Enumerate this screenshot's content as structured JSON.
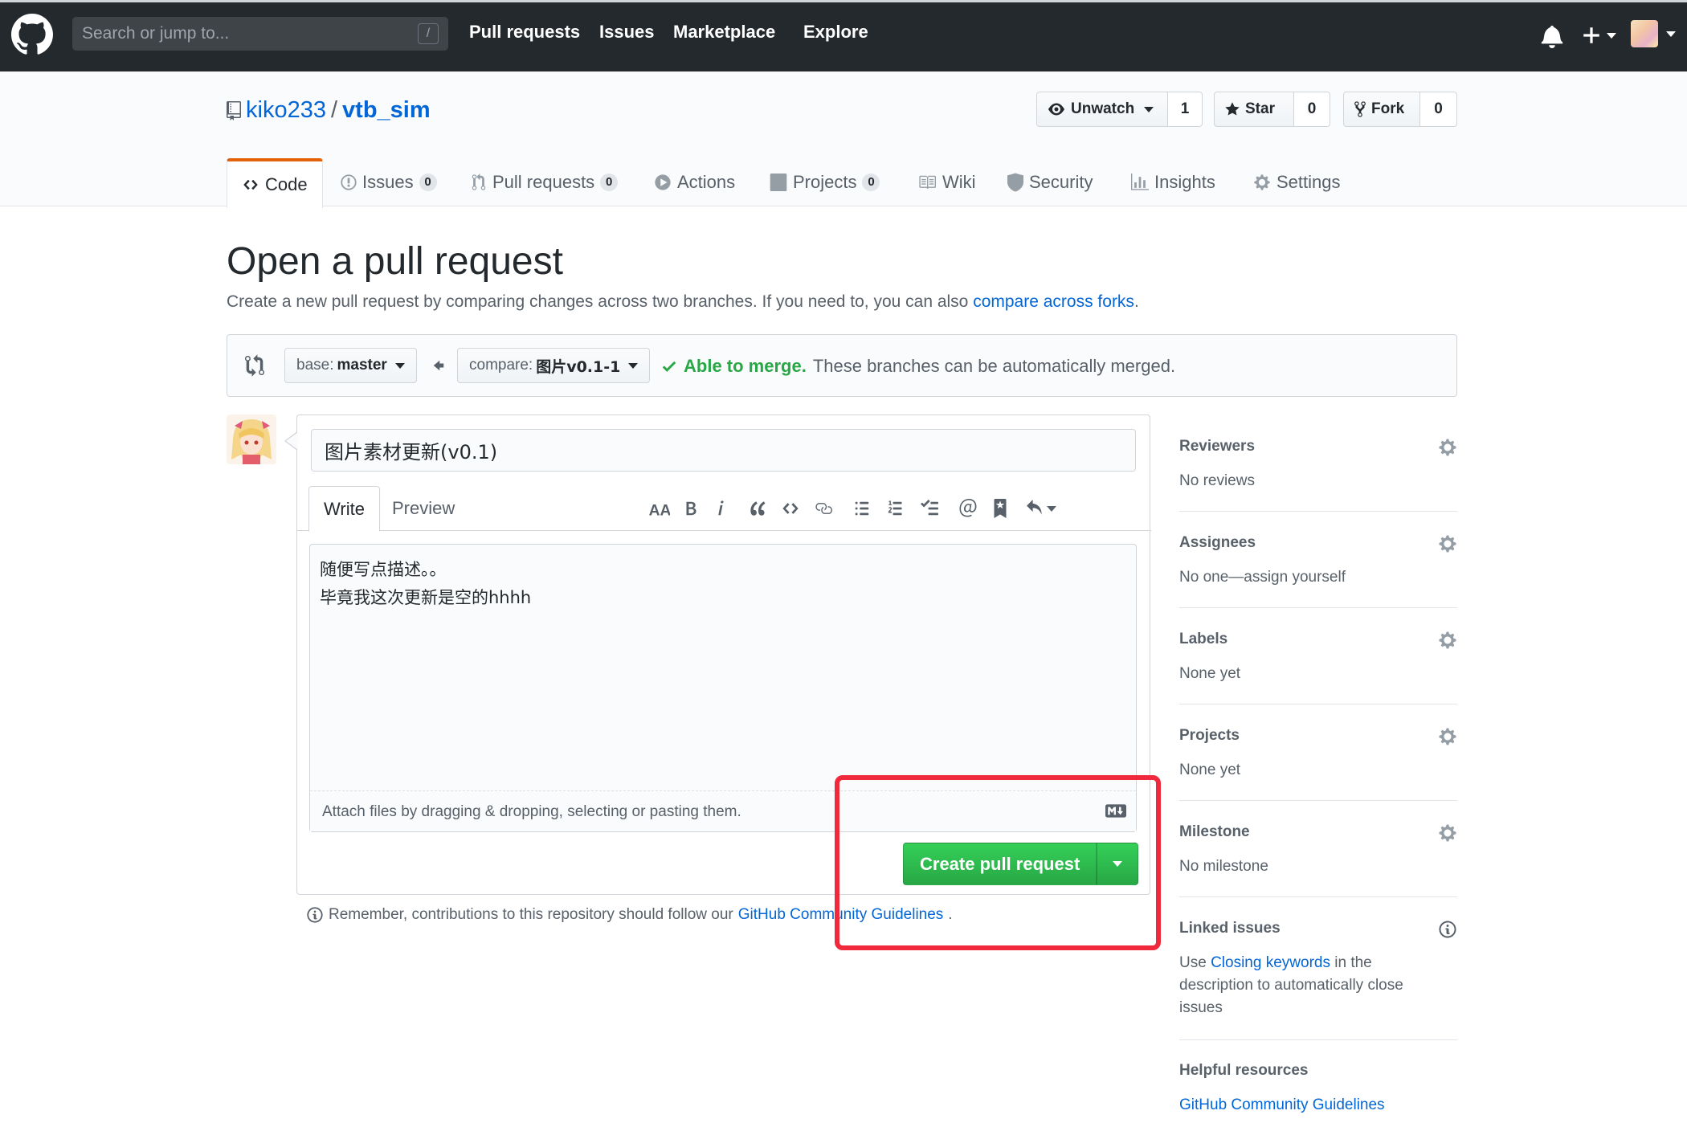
{
  "topnav": {
    "search_placeholder": "Search or jump to...",
    "slash_key": "/",
    "links": [
      "Pull requests",
      "Issues",
      "Marketplace",
      "Explore"
    ]
  },
  "repo": {
    "owner": "kiko233",
    "separator": "/",
    "name": "vtb_sim",
    "unwatch_label": "Unwatch",
    "watch_count": "1",
    "star_label": "Star",
    "star_count": "0",
    "fork_label": "Fork",
    "fork_count": "0"
  },
  "tabs": [
    {
      "label": "Code",
      "icon": "code-icon",
      "count": ""
    },
    {
      "label": "Issues",
      "icon": "issue-icon",
      "count": "0"
    },
    {
      "label": "Pull requests",
      "icon": "pull-request-icon",
      "count": "0"
    },
    {
      "label": "Actions",
      "icon": "play-icon",
      "count": ""
    },
    {
      "label": "Projects",
      "icon": "project-icon",
      "count": "0"
    },
    {
      "label": "Wiki",
      "icon": "book-icon",
      "count": ""
    },
    {
      "label": "Security",
      "icon": "shield-icon",
      "count": ""
    },
    {
      "label": "Insights",
      "icon": "graph-icon",
      "count": ""
    },
    {
      "label": "Settings",
      "icon": "gear-icon",
      "count": ""
    }
  ],
  "page": {
    "title": "Open a pull request",
    "subtitle_prefix": "Create a new pull request by comparing changes across two branches. If you need to, you can also ",
    "subtitle_link": "compare across forks",
    "subtitle_suffix": "."
  },
  "range": {
    "base_prefix": "base: ",
    "base_branch": "master",
    "compare_prefix": "compare: ",
    "compare_branch": "图片v0.1-1",
    "merge_status": "Able to merge.",
    "merge_detail": "These branches can be automatically merged."
  },
  "composer": {
    "title_value": "图片素材更新(v0.1)",
    "tab_write": "Write",
    "tab_preview": "Preview",
    "body_value": "随便写点描述。。\n毕竟我这次更新是空的hhhh",
    "attach_hint": "Attach files by dragging & dropping, selecting or pasting them.",
    "create_label": "Create pull request",
    "toolbar_icons": [
      "text-size-icon",
      "bold-icon",
      "italic-icon",
      "quote-icon",
      "code-icon",
      "link-icon",
      "unordered-list-icon",
      "ordered-list-icon",
      "task-list-icon",
      "mention-icon",
      "bookmark-icon",
      "reply-icon"
    ]
  },
  "remember": {
    "prefix": "Remember, contributions to this repository should follow our ",
    "link": "GitHub Community Guidelines",
    "suffix": "."
  },
  "sidebar": {
    "reviewers": {
      "heading": "Reviewers",
      "value": "No reviews"
    },
    "assignees": {
      "heading": "Assignees",
      "value": "No one—assign yourself"
    },
    "labels": {
      "heading": "Labels",
      "value": "None yet"
    },
    "projects": {
      "heading": "Projects",
      "value": "None yet"
    },
    "milestone": {
      "heading": "Milestone",
      "value": "No milestone"
    },
    "linked": {
      "heading": "Linked issues",
      "prefix": "Use ",
      "link": "Closing keywords",
      "suffix": " in the description to automatically close issues"
    },
    "helpful": {
      "heading": "Helpful resources",
      "link": "GitHub Community Guidelines"
    }
  },
  "colors": {
    "header_bg": "#24292e",
    "link": "#0366d6",
    "success": "#28a745",
    "highlight": "#f02a3c",
    "active_tab": "#e36209"
  }
}
